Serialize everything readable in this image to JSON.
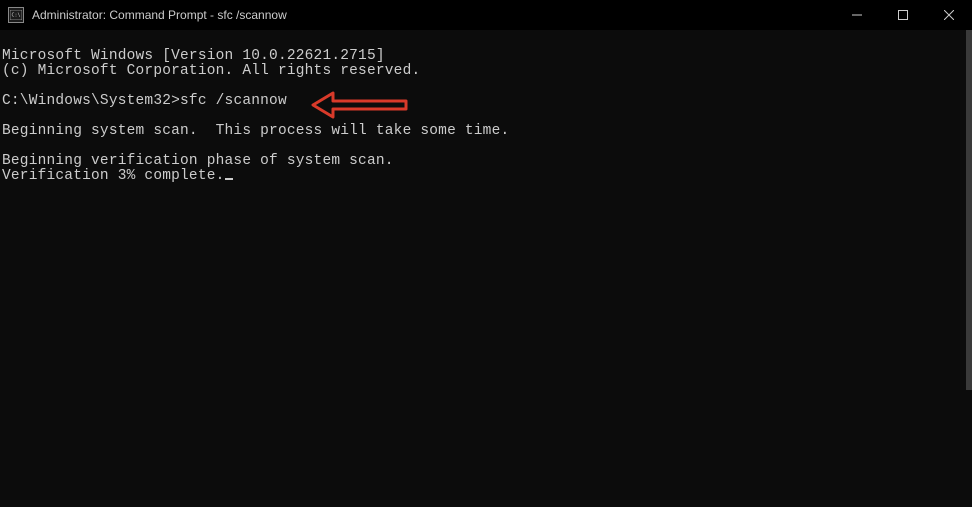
{
  "titlebar": {
    "icon_label": "cmd-icon",
    "title": "Administrator: Command Prompt - sfc  /scannow"
  },
  "terminal": {
    "lines": {
      "version": "Microsoft Windows [Version 10.0.22621.2715]",
      "copyright": "(c) Microsoft Corporation. All rights reserved.",
      "prompt": "C:\\Windows\\System32>",
      "command": "sfc /scannow",
      "scan_begin": "Beginning system scan.  This process will take some time.",
      "verify_begin": "Beginning verification phase of system scan.",
      "verify_progress": "Verification 3% complete."
    }
  },
  "annotation": {
    "arrow_color": "#d93a2a"
  }
}
